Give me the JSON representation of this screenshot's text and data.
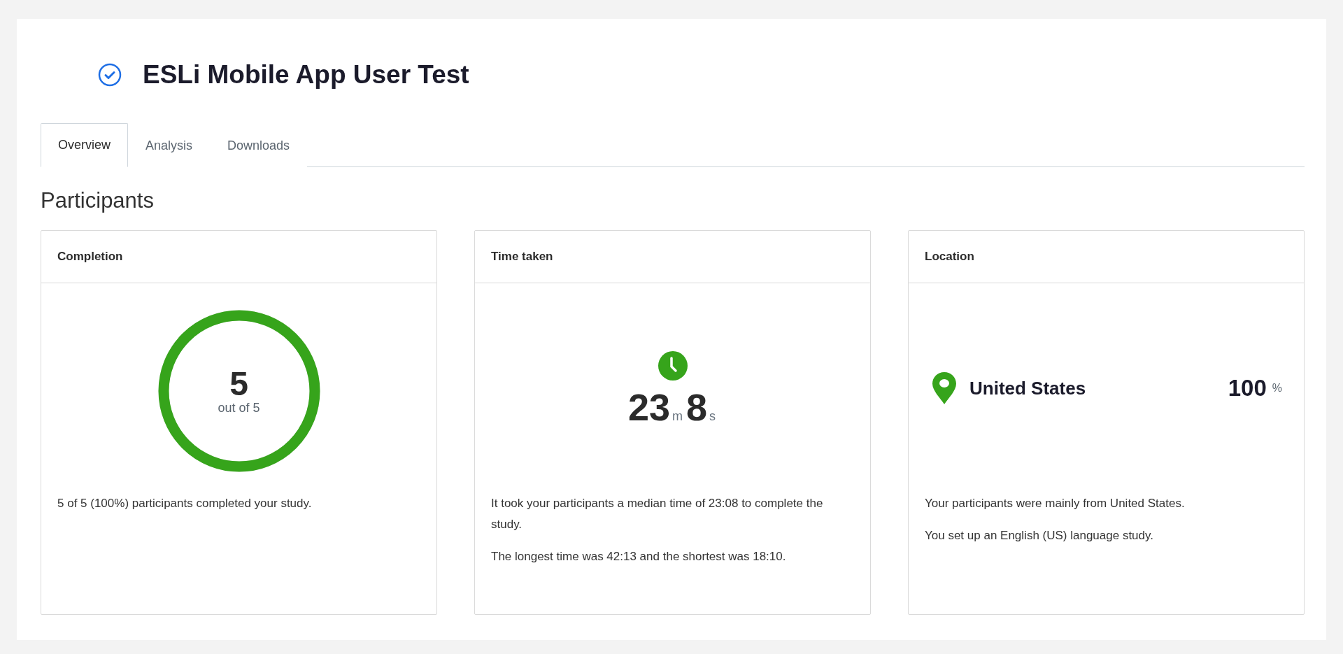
{
  "header": {
    "title": "ESLi Mobile App User Test",
    "completed": true
  },
  "tabs": [
    {
      "label": "Overview",
      "selected": true
    },
    {
      "label": "Analysis",
      "selected": false
    },
    {
      "label": "Downloads",
      "selected": false
    }
  ],
  "section_title": "Participants",
  "cards": [
    {
      "kind": "completion",
      "title": "Completion",
      "count": "5",
      "caption": "out of 5",
      "level": 1,
      "paragraphs": [
        "5 of 5 (100%) participants completed your study."
      ]
    },
    {
      "kind": "time",
      "title": "Time taken",
      "minutes": "23",
      "minutes_unit": "m",
      "seconds": "8",
      "seconds_unit": "s",
      "paragraphs": [
        "It took your participants a median time of 23:08 to complete the study.",
        "The longest time was 42:13 and the shortest was 18:10."
      ]
    },
    {
      "kind": "location",
      "title": "Location",
      "country": "United States",
      "percent": "100",
      "percent_unit": "%",
      "paragraphs": [
        "Your participants were mainly from United States.",
        "You set up an English (US) language study."
      ]
    }
  ]
}
